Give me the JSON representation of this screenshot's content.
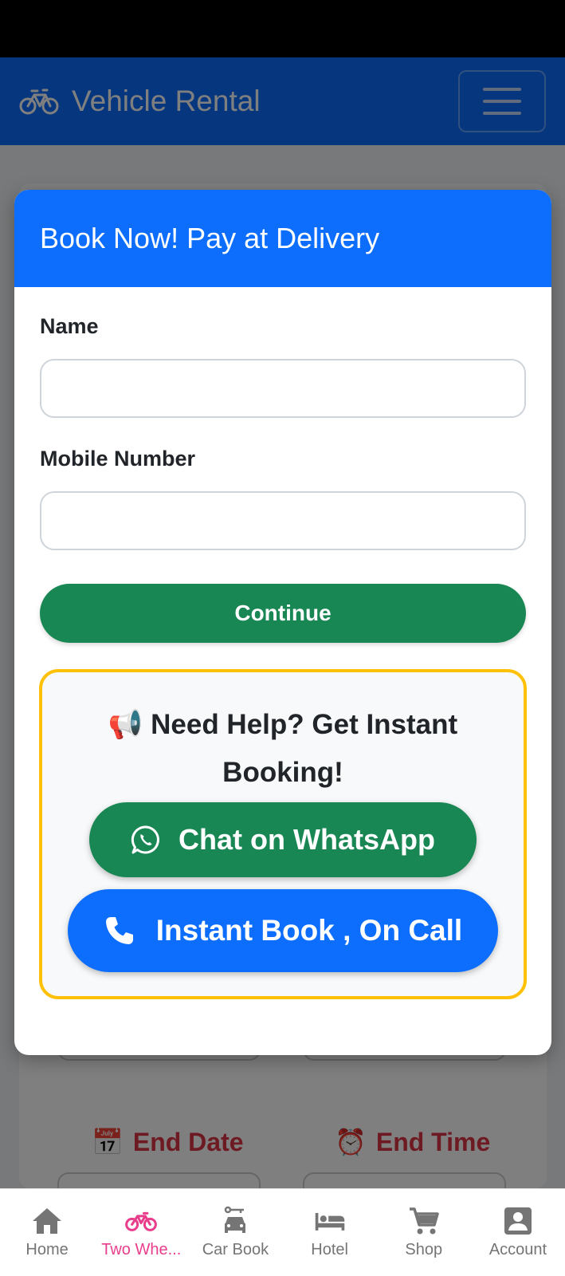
{
  "app": {
    "brand_title": "Vehicle Rental"
  },
  "background": {
    "end_date_label": "End Date",
    "end_time_label": "End Time",
    "end_date_emoji": "📅",
    "end_time_emoji": "⏰"
  },
  "modal": {
    "title": "Book Now! Pay at Delivery",
    "name_label": "Name",
    "name_value": "",
    "mobile_label": "Mobile Number",
    "mobile_value": "",
    "continue_label": "Continue",
    "help": {
      "emoji": "📢",
      "title": "Need Help? Get Instant Booking!",
      "whatsapp_label": "Chat on WhatsApp",
      "call_label": "Instant Book , On Call"
    }
  },
  "bottom_nav": {
    "items": [
      {
        "label": "Home",
        "icon": "home-icon"
      },
      {
        "label": "Two Whe...",
        "icon": "motorcycle-icon",
        "active": true
      },
      {
        "label": "Car Book",
        "icon": "car-icon"
      },
      {
        "label": "Hotel",
        "icon": "bed-icon"
      },
      {
        "label": "Shop",
        "icon": "cart-icon"
      },
      {
        "label": "Account",
        "icon": "account-icon"
      }
    ]
  },
  "colors": {
    "primary": "#0d6efd",
    "success": "#198754",
    "warning": "#ffc107",
    "danger": "#dc3545",
    "active_nav": "#e83e8c"
  }
}
